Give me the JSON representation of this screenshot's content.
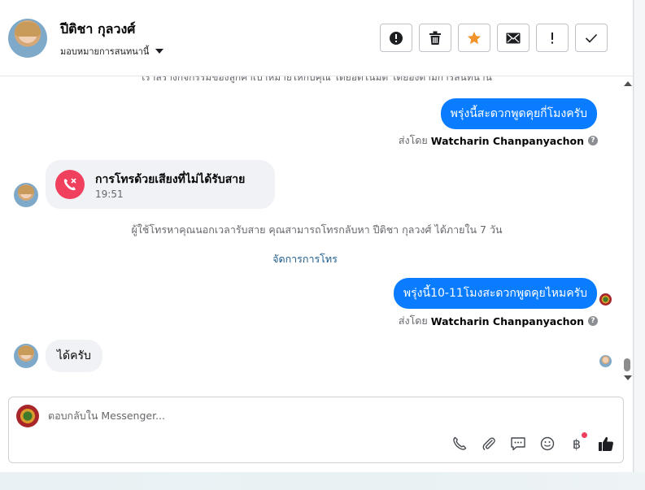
{
  "header": {
    "contact_name": "ปีติชา กุลวงศ์",
    "assign_label": "มอบหมายการสนทนานี้",
    "actions": [
      {
        "name": "spam-button",
        "icon": "alert-circle-icon"
      },
      {
        "name": "delete-button",
        "icon": "trash-icon"
      },
      {
        "name": "star-button",
        "icon": "star-icon"
      },
      {
        "name": "mark-unread-button",
        "icon": "envelope-icon"
      },
      {
        "name": "follow-up-button",
        "icon": "exclamation-icon"
      },
      {
        "name": "done-button",
        "icon": "check-icon"
      }
    ]
  },
  "thread": {
    "cut_off_text": "เราสร้างกิจกรรมของลูกค้าเป้าหมายให้กับคุณ โดยอัตโนมัติ โดยอิงตามการสนทนานี้",
    "msg1": "พรุ่งนี้สะดวกพูดคุยกี่โมงครับ",
    "sent_by_prefix": "ส่งโดย",
    "sender_name": "Watcharin Chanpanyachon",
    "missed_call_title": "การโทรด้วยเสียงที่ไม่ได้รับสาย",
    "missed_call_time": "19:51",
    "info_line": "ผู้ใช้โทรหาคุณนอกเวลารับสาย คุณสามารถโทรกลับหา ปีติชา กุลวงศ์ ได้ภายใน 7 วัน",
    "manage_calls": "จัดการการโทร",
    "msg2": "พรุ่งนี้10-11โมงสะดวกพูดคุยไหมครับ",
    "reply": "ได้ครับ"
  },
  "composer": {
    "placeholder": "ตอบกลับใน Messenger...",
    "tools": [
      "phone-icon",
      "paperclip-icon",
      "chat-bubble-icon",
      "smiley-icon",
      "baht-icon",
      "thumbs-up-icon"
    ],
    "baht_symbol": "฿"
  },
  "colors": {
    "accent": "#0a7cff",
    "star": "#f0932b",
    "missed_call": "#f0405e",
    "link": "#1b5a8c"
  }
}
